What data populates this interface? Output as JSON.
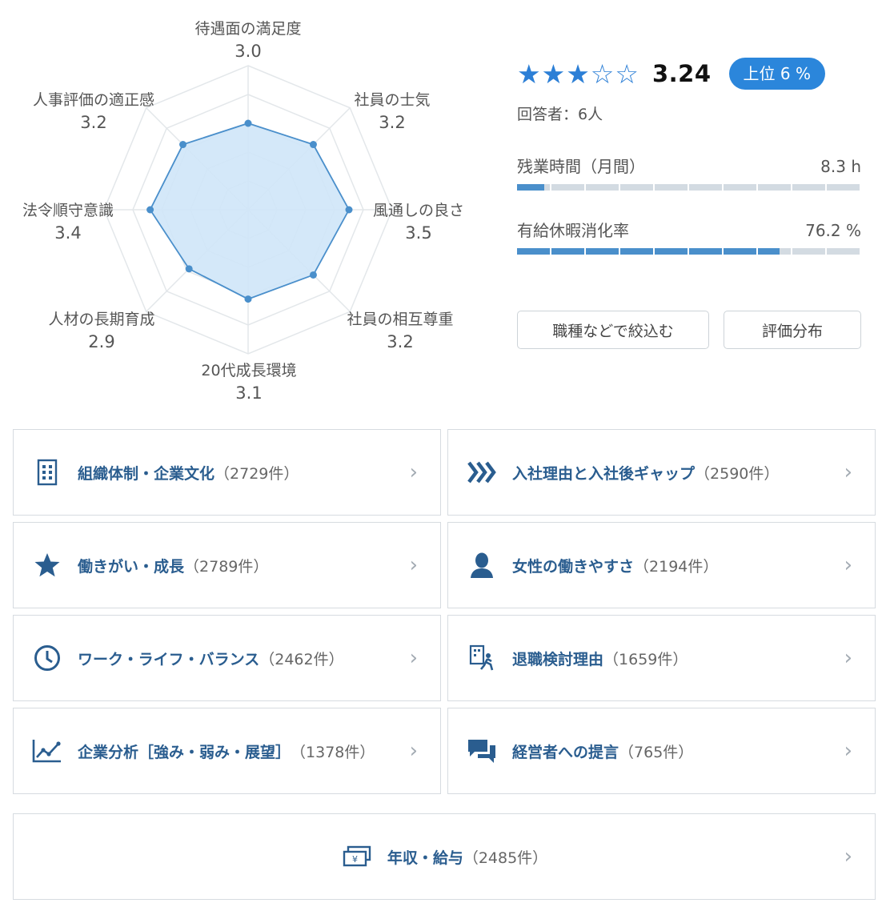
{
  "radar": {
    "max": 5,
    "axes": [
      {
        "name": "待遇面の満足度",
        "value_label": "3.0",
        "value": 3.0
      },
      {
        "name": "社員の士気",
        "value_label": "3.2",
        "value": 3.2
      },
      {
        "name": "風通しの良さ",
        "value_label": "3.5",
        "value": 3.5
      },
      {
        "name": "社員の相互尊重",
        "value_label": "3.2",
        "value": 3.2
      },
      {
        "name": "20代成長環境",
        "value_label": "3.1",
        "value": 3.1
      },
      {
        "name": "人材の長期育成",
        "value_label": "2.9",
        "value": 2.9
      },
      {
        "name": "法令順守意識",
        "value_label": "3.4",
        "value": 3.4
      },
      {
        "name": "人事評価の適正感",
        "value_label": "3.2",
        "value": 3.2
      }
    ],
    "colors": {
      "fill": "#cfe6f8",
      "stroke": "#4a8fcb",
      "grid": "#e3e7ea"
    }
  },
  "summary": {
    "stars": [
      "full",
      "full",
      "full",
      "empty",
      "empty"
    ],
    "score": "3.24",
    "rank": "上位 6 %",
    "respondents": "回答者：6人"
  },
  "metrics": {
    "overtime": {
      "label": "残業時間（月間）",
      "value": "8.3 h",
      "ratio": 0.08
    },
    "paid_leave": {
      "label": "有給休暇消化率",
      "value": "76.2 %",
      "ratio": 0.762
    }
  },
  "buttons": {
    "filter": "職種などで絞込む",
    "distribution": "評価分布"
  },
  "categories": [
    {
      "label": "組織体制・企業文化",
      "count": "（2729件）",
      "icon": "building-icon"
    },
    {
      "label": "入社理由と入社後ギャップ",
      "count": "（2590件）",
      "icon": "chevrons-icon"
    },
    {
      "label": "働きがい・成長",
      "count": "（2789件）",
      "icon": "star-icon"
    },
    {
      "label": "女性の働きやすさ",
      "count": "（2194件）",
      "icon": "person-icon"
    },
    {
      "label": "ワーク・ライフ・バランス",
      "count": "（2462件）",
      "icon": "clock-icon"
    },
    {
      "label": "退職検討理由",
      "count": "（1659件）",
      "icon": "exit-icon"
    },
    {
      "label": "企業分析［強み・弱み・展望］",
      "count": "（1378件）",
      "icon": "chart-icon"
    },
    {
      "label": "経営者への提言",
      "count": "（765件）",
      "icon": "chat-icon"
    },
    {
      "label": "年収・給与",
      "count": "（2485件）",
      "icon": "money-icon"
    }
  ],
  "chevron": "›",
  "accent": "#2b86db",
  "text_color": "#2a5d8f"
}
